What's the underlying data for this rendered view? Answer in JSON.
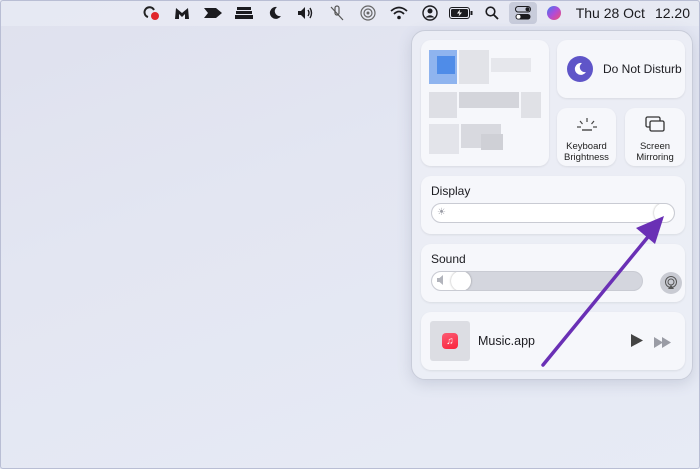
{
  "menubar": {
    "icons": [
      "creative-cloud-icon",
      "malwarebytes-icon",
      "app-icon",
      "stack-icon",
      "moon-icon",
      "volume-icon",
      "mute-mic-icon",
      "airdrop-icon",
      "wifi-icon",
      "user-icon",
      "battery-icon",
      "search-icon",
      "control-center-icon",
      "siri-icon"
    ],
    "date": "Thu 28 Oct",
    "time": "12.20"
  },
  "control_center": {
    "dnd_label": "Do Not Disturb",
    "keyboard_label": "Keyboard Brightness",
    "mirroring_label": "Screen Mirroring",
    "display": {
      "title": "Display",
      "brightness": 1.0
    },
    "sound": {
      "title": "Sound",
      "volume": 0.1
    },
    "now_playing": {
      "app": "Music.app"
    }
  },
  "colors": {
    "dnd": "#5f55c8",
    "arrow": "#6a30b5",
    "music": "#fa233b"
  }
}
